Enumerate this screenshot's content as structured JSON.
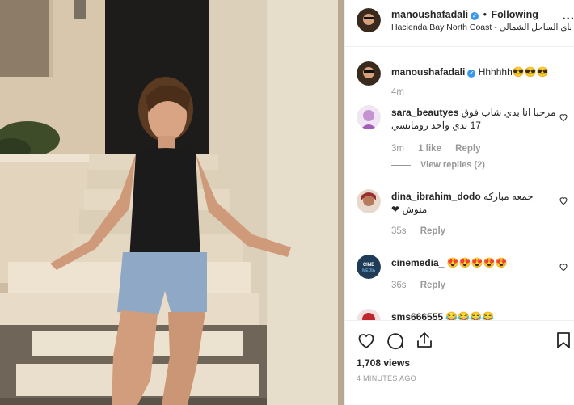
{
  "post": {
    "username": "manoushafadali",
    "follow_status": "Following",
    "location": "Hacienda Bay North Coast - بلدنا باى الساحل الشمالى",
    "more_label": "..."
  },
  "comments": [
    {
      "username": "manoushafadali",
      "text": "Hhhhhh😎😎😎",
      "time": "4m",
      "likes": "",
      "reply": "",
      "verified": true
    },
    {
      "username": "sara_beautyes",
      "text": "مرحبا انا بدي شاب فوق 17 بدي واحد رومانسي",
      "time": "3m",
      "likes": "1 like",
      "reply": "Reply",
      "view_replies": "View replies (2)"
    },
    {
      "username": "dina_ibrahim_dodo",
      "text": "جمعه مباركه منوش ❤",
      "time": "35s",
      "reply": "Reply"
    },
    {
      "username": "cinemedia_",
      "text": "😍😍😍😍😍",
      "time": "36s",
      "reply": "Reply",
      "avatar_text": "CINE MEDIA"
    },
    {
      "username": "sms666555",
      "text": "😂😂😂😂",
      "time": ""
    }
  ],
  "stats": {
    "views": "1,708 views",
    "time_ago": "4 MINUTES AGO"
  },
  "icons": [
    "heart-icon",
    "comment-icon",
    "share-icon",
    "bookmark-icon",
    "verified-badge-icon"
  ],
  "colors": {
    "accent": "#3897f0",
    "muted": "#999999",
    "text": "#262626"
  }
}
